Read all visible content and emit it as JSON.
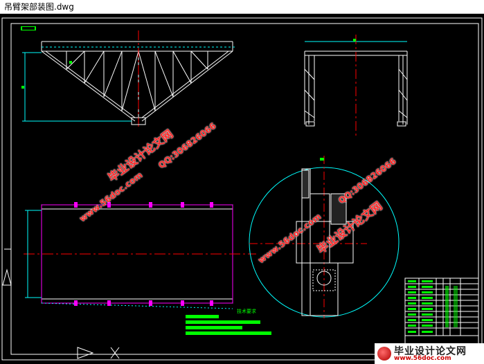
{
  "window": {
    "title": "吊臂架部装图.dwg"
  },
  "drawing": {
    "frame_color": "#ffffff",
    "line_cyan": "#00ffff",
    "line_red": "#ff0000",
    "line_magenta": "#ff00ff",
    "line_green": "#00ff00",
    "tech_requirements_title": "技术要求"
  },
  "watermarks": {
    "site_name": "毕业设计论文网",
    "site_url": "www.56doc.com",
    "qq": "QQ:306826066"
  },
  "logo": {
    "name": "毕业设计论文网",
    "url": "www.56doc.com"
  }
}
